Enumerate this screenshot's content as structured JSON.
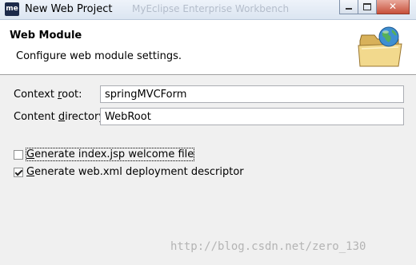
{
  "window": {
    "title": "New Web Project",
    "background_title": "MyEclipse Enterprise Workbench",
    "app_icon_text": "me",
    "controls": [
      "minimize-icon",
      "maximize-icon",
      "close-icon"
    ]
  },
  "header": {
    "title": "Web Module",
    "description": "Configure web module settings.",
    "icon": "folder-globe-icon"
  },
  "form": {
    "context_root": {
      "label_pre": "Context ",
      "label_mnemonic": "r",
      "label_post": "oot:",
      "value": "springMVCForm"
    },
    "content_directory": {
      "label_pre": "Content ",
      "label_mnemonic": "d",
      "label_post": "irectory:",
      "value": "WebRoot"
    }
  },
  "options": {
    "generate_index": {
      "mnemonic": "G",
      "label_rest": "enerate index.jsp welcome file",
      "checked": false
    },
    "generate_webxml": {
      "mnemonic": "G",
      "label_rest": "enerate web.xml deployment descriptor",
      "checked": true
    }
  },
  "watermark": "http://blog.csdn.net/zero_130"
}
